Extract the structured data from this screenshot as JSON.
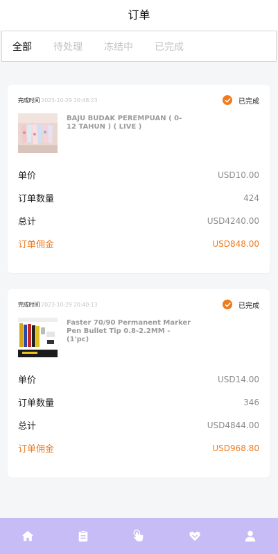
{
  "header": {
    "title": "订单"
  },
  "tabs": [
    {
      "label": "全部",
      "active": true
    },
    {
      "label": "待处理",
      "active": false
    },
    {
      "label": "冻结中",
      "active": false
    },
    {
      "label": "已完成",
      "active": false
    }
  ],
  "orders": [
    {
      "time_label": "完成时间",
      "time_value": "2023-10-29 20:48:23",
      "status": "已完成",
      "product_name": "BAJU BUDAK PEREMPUAN ( 0-12 TAHUN ) ( LIVE )",
      "unit_price_label": "单价",
      "unit_price": "USD10.00",
      "quantity_label": "订单数量",
      "quantity": "424",
      "total_label": "总计",
      "total": "USD4240.00",
      "commission_label": "订单佣金",
      "commission": "USD848.00"
    },
    {
      "time_label": "完成时间",
      "time_value": "2023-10-29 20:40:13",
      "status": "已完成",
      "product_name": "Faster 70/90 Permanent Marker Pen Bullet Tip 0.8-2.2MM - (1'pc)",
      "unit_price_label": "单价",
      "unit_price": "USD14.00",
      "quantity_label": "订单数量",
      "quantity": "346",
      "total_label": "总计",
      "total": "USD4844.00",
      "commission_label": "订单佣金",
      "commission": "USD968.80"
    }
  ],
  "navbar": {
    "icons": [
      "home-icon",
      "clipboard-icon",
      "tap-hand-icon",
      "heart-icon",
      "user-icon"
    ]
  },
  "colors": {
    "accent": "#f17a1c",
    "navbar_bg": "#c8bcf6",
    "page_bg": "#f5f6f8"
  }
}
